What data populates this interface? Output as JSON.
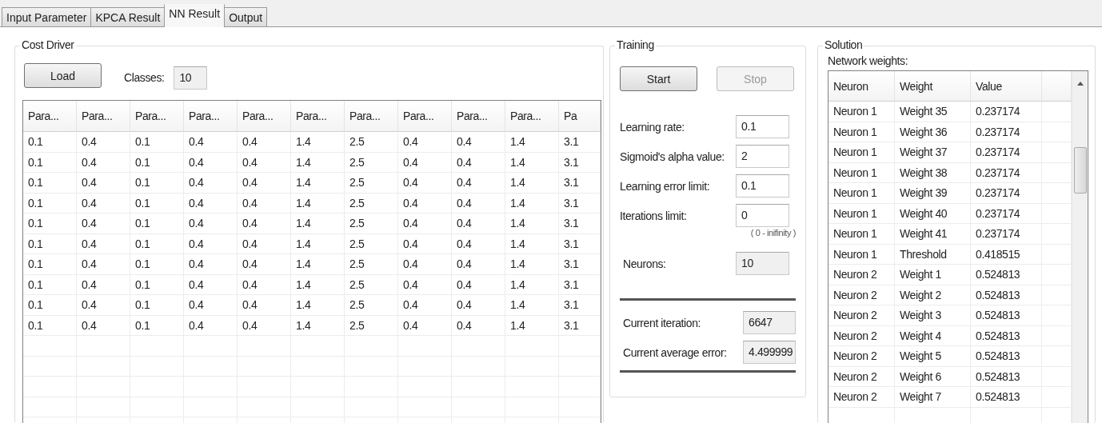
{
  "tabs": [
    {
      "label": "Input Parameter",
      "selected": false
    },
    {
      "label": "KPCA Result",
      "selected": false
    },
    {
      "label": "NN Result",
      "selected": true
    },
    {
      "label": "Output",
      "selected": false
    }
  ],
  "cost_driver": {
    "title": "Cost Driver",
    "load_button": {
      "label": "Load",
      "disabled": false
    },
    "classes_label": "Classes:",
    "classes_value": "10",
    "table": {
      "columns": [
        "Para...",
        "Para...",
        "Para...",
        "Para...",
        "Para...",
        "Para...",
        "Para...",
        "Para...",
        "Para...",
        "Para...",
        "Pa"
      ],
      "rows": [
        [
          "0.1",
          "0.4",
          "0.1",
          "0.4",
          "0.4",
          "1.4",
          "2.5",
          "0.4",
          "0.4",
          "1.4",
          "3.1"
        ],
        [
          "0.1",
          "0.4",
          "0.1",
          "0.4",
          "0.4",
          "1.4",
          "2.5",
          "0.4",
          "0.4",
          "1.4",
          "3.1"
        ],
        [
          "0.1",
          "0.4",
          "0.1",
          "0.4",
          "0.4",
          "1.4",
          "2.5",
          "0.4",
          "0.4",
          "1.4",
          "3.1"
        ],
        [
          "0.1",
          "0.4",
          "0.1",
          "0.4",
          "0.4",
          "1.4",
          "2.5",
          "0.4",
          "0.4",
          "1.4",
          "3.1"
        ],
        [
          "0.1",
          "0.4",
          "0.1",
          "0.4",
          "0.4",
          "1.4",
          "2.5",
          "0.4",
          "0.4",
          "1.4",
          "3.1"
        ],
        [
          "0.1",
          "0.4",
          "0.1",
          "0.4",
          "0.4",
          "1.4",
          "2.5",
          "0.4",
          "0.4",
          "1.4",
          "3.1"
        ],
        [
          "0.1",
          "0.4",
          "0.1",
          "0.4",
          "0.4",
          "1.4",
          "2.5",
          "0.4",
          "0.4",
          "1.4",
          "3.1"
        ],
        [
          "0.1",
          "0.4",
          "0.1",
          "0.4",
          "0.4",
          "1.4",
          "2.5",
          "0.4",
          "0.4",
          "1.4",
          "3.1"
        ],
        [
          "0.1",
          "0.4",
          "0.1",
          "0.4",
          "0.4",
          "1.4",
          "2.5",
          "0.4",
          "0.4",
          "1.4",
          "3.1"
        ],
        [
          "0.1",
          "0.4",
          "0.1",
          "0.4",
          "0.4",
          "1.4",
          "2.5",
          "0.4",
          "0.4",
          "1.4",
          "3.1"
        ]
      ]
    }
  },
  "training": {
    "title": "Training",
    "buttons": [
      {
        "label": "Start",
        "disabled": false
      },
      {
        "label": "Stop",
        "disabled": true
      }
    ],
    "fields": [
      {
        "label": "Learning rate:",
        "value": "0.1",
        "readonly": false
      },
      {
        "label": "Sigmoid's alpha value:",
        "value": "2",
        "readonly": false
      },
      {
        "label": "Learning error limit:",
        "value": "0.1",
        "readonly": false
      },
      {
        "label": "Iterations limit:",
        "value": "0",
        "readonly": false,
        "hint": "( 0 - inifinity )"
      }
    ],
    "neurons": {
      "label": "Neurons:",
      "value": "10",
      "readonly": true
    },
    "status": [
      {
        "label": "Current iteration:",
        "value": "6647",
        "readonly": true
      },
      {
        "label": "Current average error:",
        "value": "4.499999",
        "readonly": true
      }
    ]
  },
  "solution": {
    "title": "Solution",
    "weights_label": "Network weights:",
    "columns": [
      "Neuron",
      "Weight",
      "Value"
    ],
    "rows": [
      [
        "Neuron 1",
        "Weight 35",
        "0.237174"
      ],
      [
        "Neuron 1",
        "Weight 36",
        "0.237174"
      ],
      [
        "Neuron 1",
        "Weight 37",
        "0.237174"
      ],
      [
        "Neuron 1",
        "Weight 38",
        "0.237174"
      ],
      [
        "Neuron 1",
        "Weight 39",
        "0.237174"
      ],
      [
        "Neuron 1",
        "Weight 40",
        "0.237174"
      ],
      [
        "Neuron 1",
        "Weight 41",
        "0.237174"
      ],
      [
        "Neuron 1",
        "Threshold",
        "0.418515"
      ],
      [
        "Neuron 2",
        "Weight 1",
        "0.524813"
      ],
      [
        "Neuron 2",
        "Weight 2",
        "0.524813"
      ],
      [
        "Neuron 2",
        "Weight 3",
        "0.524813"
      ],
      [
        "Neuron 2",
        "Weight 4",
        "0.524813"
      ],
      [
        "Neuron 2",
        "Weight 5",
        "0.524813"
      ],
      [
        "Neuron 2",
        "Weight 6",
        "0.524813"
      ],
      [
        "Neuron 2",
        "Weight 7",
        "0.524813"
      ]
    ]
  }
}
